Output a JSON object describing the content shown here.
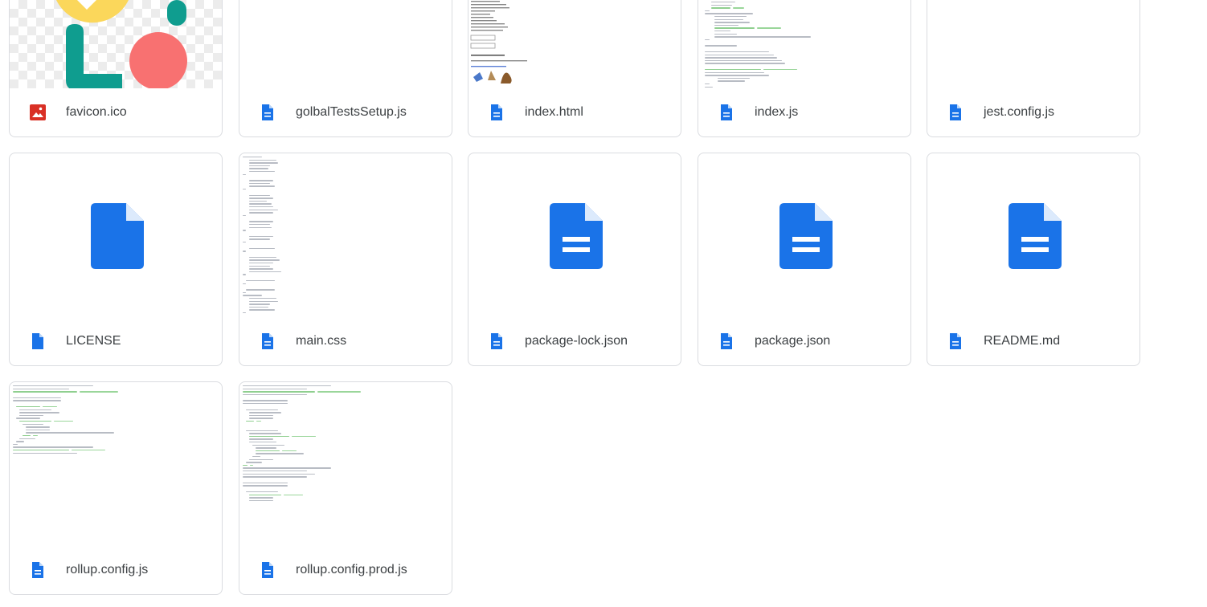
{
  "files": [
    {
      "name": "favicon.ico",
      "type": "image",
      "preview": "favicon"
    },
    {
      "name": "golbalTestsSetup.js",
      "type": "doc",
      "preview": "blank"
    },
    {
      "name": "index.html",
      "type": "doc",
      "preview": "html"
    },
    {
      "name": "index.js",
      "type": "doc",
      "preview": "code"
    },
    {
      "name": "jest.config.js",
      "type": "doc",
      "preview": "blank"
    },
    {
      "name": "LICENSE",
      "type": "file",
      "preview": "generic-file-icon"
    },
    {
      "name": "main.css",
      "type": "doc",
      "preview": "code"
    },
    {
      "name": "package-lock.json",
      "type": "doc",
      "preview": "generic-doc-icon"
    },
    {
      "name": "package.json",
      "type": "doc",
      "preview": "generic-doc-icon"
    },
    {
      "name": "README.md",
      "type": "doc",
      "preview": "generic-doc-icon"
    },
    {
      "name": "rollup.config.js",
      "type": "doc",
      "preview": "code"
    },
    {
      "name": "rollup.config.prod.js",
      "type": "doc",
      "preview": "code"
    }
  ],
  "colors": {
    "doc_icon": "#1a73e8",
    "image_icon": "#d93025",
    "card_border": "#dadce0",
    "favicon_yellow": "#fbd75b",
    "favicon_teal": "#0f9d8f",
    "favicon_red": "#f87171"
  }
}
